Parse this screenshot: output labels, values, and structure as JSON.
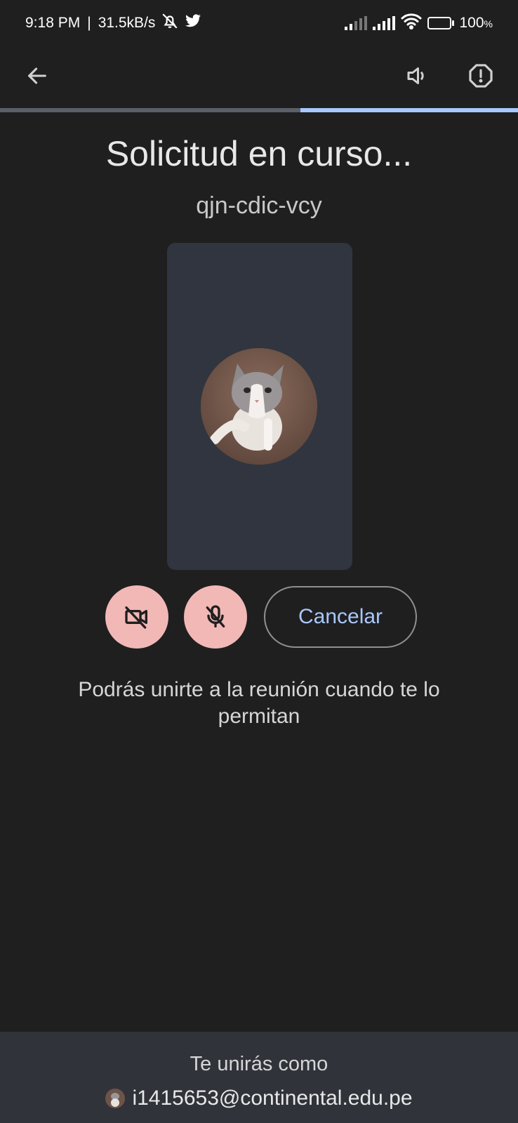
{
  "status_bar": {
    "time": "9:18 PM",
    "separator": "|",
    "speed": "31.5kB/s",
    "battery": "100",
    "battery_unit": "%"
  },
  "header": {
    "back_icon": "back-arrow-icon",
    "speaker_icon": "speaker-icon",
    "report_icon": "report-icon"
  },
  "progress": {
    "fraction": 0.42
  },
  "main": {
    "title": "Solicitud en curso...",
    "meeting_code": "qjn-cdic-vcy",
    "info_text": "Podrás unirte a la reunión cuando te lo permitan"
  },
  "controls": {
    "cancel_label": "Cancelar",
    "camera_icon": "camera-off-icon",
    "mic_icon": "mic-off-icon",
    "button_color": "#f2b8b5",
    "accent": "#a8c7fa"
  },
  "footer": {
    "label": "Te unirás como",
    "account": "i1415653@continental.edu.pe"
  }
}
